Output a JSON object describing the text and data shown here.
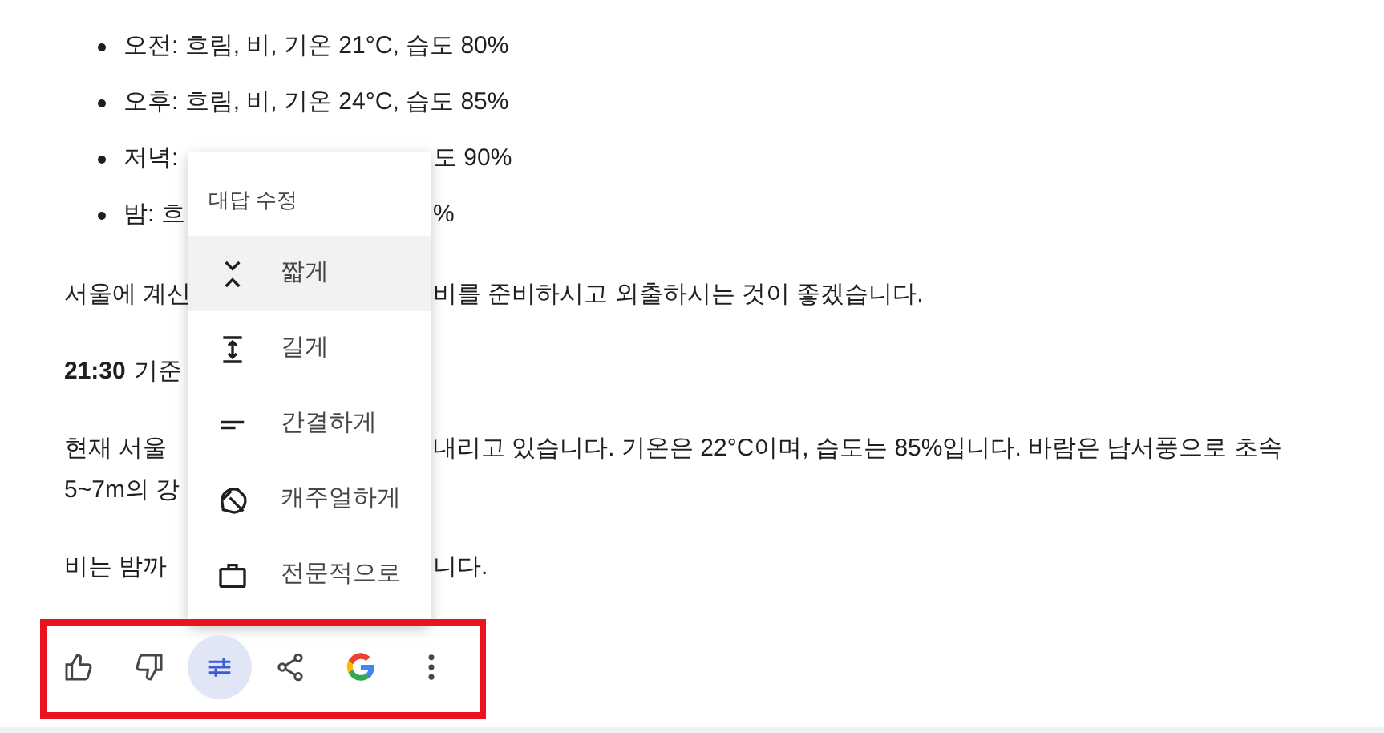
{
  "bullets": [
    {
      "left": "오전: 흐림, 비, 기온 21°C, 습도 80%"
    },
    {
      "left": "오후: 흐림, 비, 기온 24°C, 습도 85%"
    },
    {
      "left": "저녁:",
      "right": "도 90%"
    },
    {
      "left": "밤: 흐",
      "right": "%"
    }
  ],
  "paragraphs": [
    {
      "lines": [
        {
          "left": "서울에 계신",
          "right": "비를 준비하시고 외출하시는 것이 좋겠습니다."
        }
      ]
    },
    {
      "bold": "21:30",
      "lines": [
        {
          "left": "기준"
        }
      ]
    },
    {
      "lines": [
        {
          "left": "현재 서울",
          "right": "내리고 있습니다. 기온은 22°C이며, 습도는 85%입니다. 바람은 남서풍으로 초속"
        },
        {
          "left": "5~7m의 강"
        }
      ]
    },
    {
      "lines": [
        {
          "left": "비는 밤까",
          "right": "니다."
        }
      ]
    }
  ],
  "menu": {
    "title": "대답 수정",
    "items": [
      {
        "kind": "shorter",
        "label": "짧게",
        "selected": true
      },
      {
        "kind": "longer",
        "label": "길게",
        "selected": false
      },
      {
        "kind": "simple",
        "label": "간결하게",
        "selected": false
      },
      {
        "kind": "casual",
        "label": "캐주얼하게",
        "selected": false
      },
      {
        "kind": "professional",
        "label": "전문적으로",
        "selected": false
      }
    ]
  },
  "toolbar": [
    {
      "kind": "like",
      "selected": false
    },
    {
      "kind": "dislike",
      "selected": false
    },
    {
      "kind": "modify",
      "selected": true
    },
    {
      "kind": "share",
      "selected": false
    },
    {
      "kind": "google",
      "selected": false
    },
    {
      "kind": "more",
      "selected": false
    }
  ]
}
